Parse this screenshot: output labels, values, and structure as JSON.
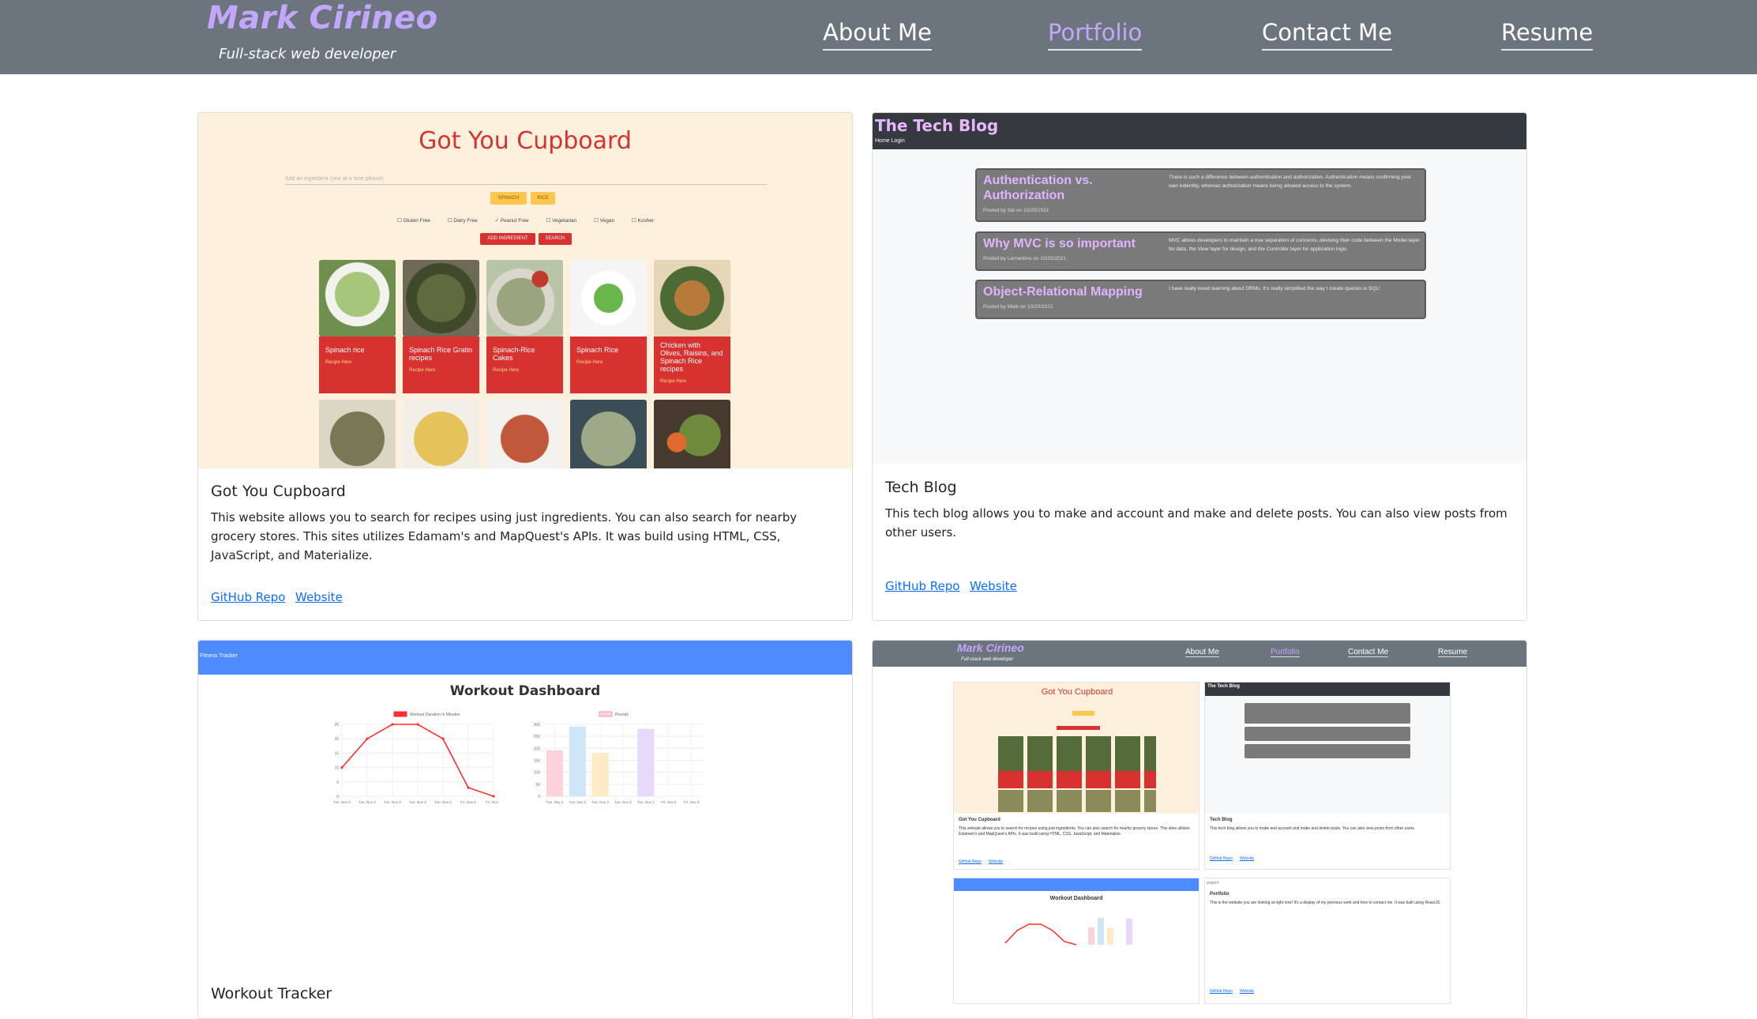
{
  "header": {
    "brand_name": "Mark Cirineo",
    "brand_tagline": "Full-stack web developer",
    "nav": [
      {
        "label": "About Me"
      },
      {
        "label": "Portfolio"
      },
      {
        "label": "Contact Me"
      },
      {
        "label": "Resume"
      }
    ],
    "active_nav": "Portfolio"
  },
  "colors": {
    "header_bg": "#6c757d",
    "brand": "#c3a7ff",
    "link": "#0d6efd",
    "cupboard_bg": "#fdf1de",
    "cupboard_red": "#d7322f"
  },
  "projects": [
    {
      "title": "Got You Cupboard",
      "description": "This website allows you to search for recipes using just ingredients. You can also search for nearby grocery stores. This sites utilizes Edamam's and MapQuest's APIs. It was build using HTML, CSS, JavaScript, and Materialize.",
      "repo_label": "GitHub Repo",
      "site_label": "Website",
      "screenshot": {
        "app_title": "Got You Cupboard",
        "input_placeholder": "Add an ingredient (one at a time please)",
        "chips": [
          "SPINACH",
          "RICE"
        ],
        "filters": [
          "Gluten Free",
          "Dairy Free",
          "Peanut Free",
          "Vegetarian",
          "Vegan",
          "Kosher"
        ],
        "buttons": [
          "ADD INGREDIENT",
          "SEARCH"
        ],
        "recipes": [
          {
            "name": "Spinach rice",
            "link": "Recipe Here"
          },
          {
            "name": "Spinach Rice Gratin recipes",
            "link": "Recipe Here"
          },
          {
            "name": "Spinach-Rice Cakes",
            "link": "Recipe Here"
          },
          {
            "name": "Spinach Rice",
            "link": "Recipe Here"
          },
          {
            "name": "Chicken with Olives, Raisins, and Spinach Rice recipes",
            "link": "Recipe Here"
          }
        ]
      }
    },
    {
      "title": "Tech Blog",
      "description": "This tech blog allows you to make and account and make and delete posts. You can also view posts from other users.",
      "repo_label": "GitHub Repo",
      "site_label": "Website",
      "screenshot": {
        "app_title": "The Tech Blog",
        "nav_text": "Home Login",
        "posts": [
          {
            "title": "Authentication vs. Authorization",
            "meta": "Posted by Sal on 10/20/2021",
            "body": "There is such a difference between authentication and authorization. Authentication means confirming your own indentity, whereas authorization means being allowed access to the system."
          },
          {
            "title": "Why MVC is so important",
            "meta": "Posted by Lernantino on 10/20/2021",
            "body": "MVC allows developers to maintain a true separation of concerns, devising their code between the Model layer for data, the View layer for design, and the Controller layer for application logic."
          },
          {
            "title": "Object-Relational Mapping",
            "meta": "Posted by Mark on 10/20/2021",
            "body": "I have really loved learning about ORMs. It's really simplified the way I create queries in SQL!"
          }
        ]
      }
    },
    {
      "title": "Workout Tracker",
      "screenshot": {
        "app_title": "Fitness Tracker",
        "dashboard_title": "Workout Dashboard",
        "chart_data": [
          {
            "type": "line",
            "legend": [
              "Workout Duration In Minutes"
            ],
            "categories": [
              "Tue, Nov 2",
              "Tue, Nov 2",
              "Tue, Nov 2",
              "Tue, Nov 2",
              "Tue, Nov 2",
              "Fri, Nov 5",
              "Fri, Nov 5"
            ],
            "series": [
              {
                "name": "Workout Duration In Minutes",
                "values": [
                  10,
                  20,
                  25,
                  25,
                  20,
                  3,
                  0
                ]
              }
            ],
            "y_ticks": [
              "0",
              "5",
              "10",
              "15",
              "20",
              "25"
            ],
            "ylim": [
              0,
              25
            ],
            "color": "#ff2d2d"
          },
          {
            "type": "bar",
            "legend": [
              "Pounds"
            ],
            "categories": [
              "Tue, Nov 2",
              "Tue, Nov 2",
              "Tue, Nov 2",
              "Tue, Nov 2",
              "Tue, Nov 2",
              "Fri, Nov 5",
              "Fri, Nov 5"
            ],
            "series": [
              {
                "name": "Pounds",
                "values": [
                  190,
                  290,
                  180,
                  0,
                  280,
                  0,
                  0
                ]
              }
            ],
            "y_ticks": [
              "0",
              "50",
              "100",
              "150",
              "200",
              "250",
              "300"
            ],
            "ylim": [
              0,
              300
            ],
            "bar_colors": [
              "#fbd3da",
              "#cfe6f8",
              "#fdebc8",
              "#d6f1ef",
              "#e7d9fb",
              "#f4e0c9",
              "#e5e5e5"
            ]
          }
        ]
      }
    },
    {
      "title": "",
      "screenshot": {
        "brand_name": "Mark Cirineo",
        "brand_tagline": "Full-stack web developer",
        "nav": [
          "About Me",
          "Portfolio",
          "Contact Me",
          "Resume"
        ],
        "cards": [
          {
            "title": "Got You Cupboard",
            "desc": "This website allows you to search for recipes using just ingredients. You can also search for nearby grocery stores. This sites utilizes Edamam's and MapQuest's APIs. It was build using HTML, CSS, JavaScript, and Materialize.",
            "links": [
              "GitHub Repo",
              "Website"
            ]
          },
          {
            "title": "Tech Blog",
            "desc": "This tech blog allows you to make and account and make and delete posts. You can also view posts from other users.",
            "links": [
              "GitHub Repo",
              "Website"
            ]
          },
          {
            "title": "Workout Dashboard",
            "desc": "",
            "links": []
          },
          {
            "title": "Portfolio",
            "alt": "project",
            "desc": "This is the website you are looking at right now! It's a display of my previous work and how to contact me. It was built using ReactJS.",
            "links": [
              "GitHub Repo",
              "Website"
            ]
          }
        ]
      }
    }
  ]
}
